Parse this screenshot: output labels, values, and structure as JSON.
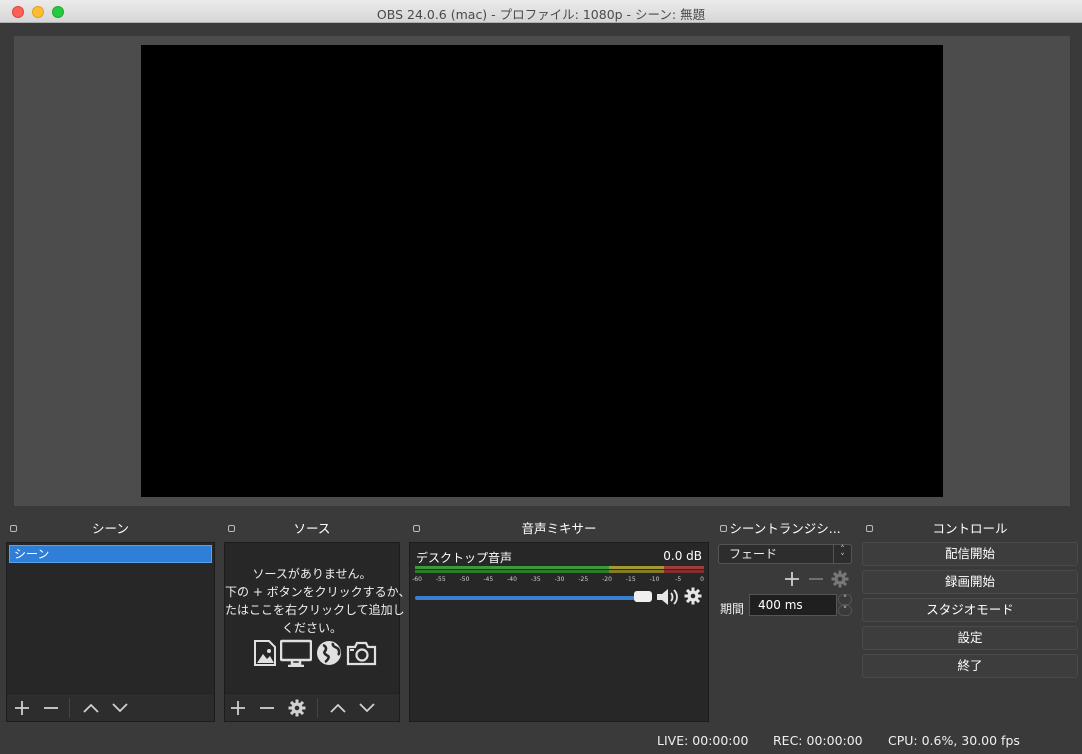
{
  "window": {
    "title": "OBS 24.0.6 (mac) - プロファイル: 1080p - シーン: 無題"
  },
  "scenes": {
    "header": "シーン",
    "items": [
      "シーン"
    ]
  },
  "sources": {
    "header": "ソース",
    "empty_lines": [
      "ソースがありません。",
      "下の + ボタンをクリックするか、",
      "たはここを右クリックして追加し",
      "ください。"
    ]
  },
  "mixer": {
    "header": "音声ミキサー",
    "channel_name": "デスクトップ音声",
    "level": "0.0 dB",
    "volume_fraction": 1.0,
    "ticks": [
      "-60",
      "-55",
      "-50",
      "-45",
      "-40",
      "-35",
      "-30",
      "-25",
      "-20",
      "-15",
      "-10",
      "-5",
      "0"
    ]
  },
  "transitions": {
    "header": "シーントランジシ...",
    "selected": "フェード",
    "duration_label": "期間",
    "duration_value": "400 ms"
  },
  "controls": {
    "header": "コントロール",
    "start_streaming": "配信開始",
    "start_recording": "録画開始",
    "studio_mode": "スタジオモード",
    "settings": "設定",
    "exit": "終了"
  },
  "status": {
    "live": "LIVE: 00:00:00",
    "rec": "REC: 00:00:00",
    "cpu": "CPU: 0.6%, 30.00 fps"
  },
  "colors": {
    "accent": "#2f7fd8",
    "background": "#3a3a3a",
    "panel": "#272727"
  }
}
